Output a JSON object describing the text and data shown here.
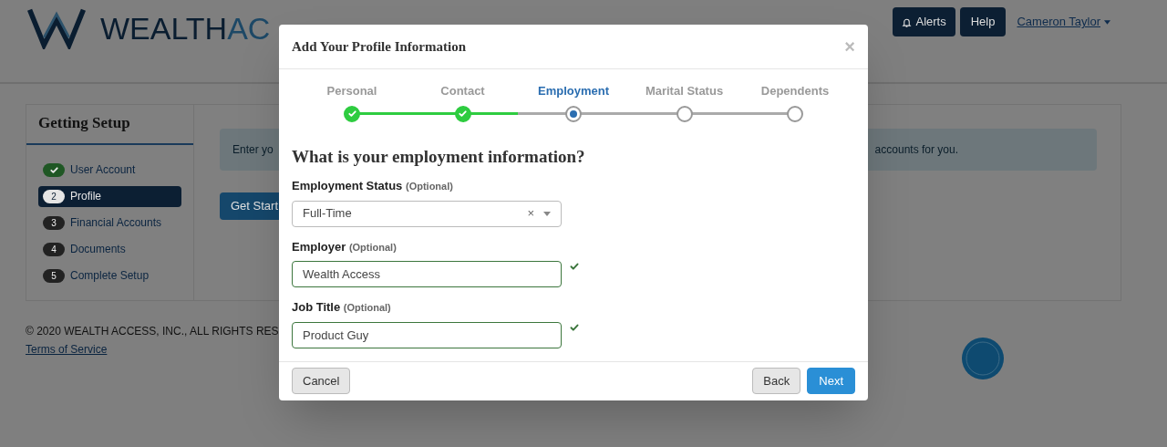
{
  "header": {
    "logo": {
      "dark": "WEALTH",
      "light": "AC"
    },
    "alerts_button": "Alerts",
    "help_button": "Help",
    "user_menu": "Cameron Taylor"
  },
  "sidebar": {
    "title": "Getting Setup",
    "items": [
      {
        "label": "User Account",
        "done": true,
        "selected": false
      },
      {
        "badge": "2",
        "label": "Profile",
        "done": false,
        "selected": true
      },
      {
        "badge": "3",
        "label": "Financial Accounts",
        "done": false,
        "selected": false
      },
      {
        "badge": "4",
        "label": "Documents",
        "done": false,
        "selected": false
      },
      {
        "badge": "5",
        "label": "Complete Setup",
        "done": false,
        "selected": false
      }
    ]
  },
  "main": {
    "notice_start": "Enter yo",
    "notice_end": "accounts for you.",
    "start_button": "Get Start"
  },
  "footer": {
    "copyright": "© 2020 WEALTH ACCESS, INC., ALL RIGHTS RES",
    "terms_link": "Terms of Service"
  },
  "modal": {
    "title": "Add Your Profile Information",
    "close": "×",
    "steps": [
      {
        "label": "Personal",
        "done": true,
        "selected": false
      },
      {
        "label": "Contact",
        "done": true,
        "selected": false
      },
      {
        "label": "Employment",
        "done": false,
        "selected": true
      },
      {
        "label": "Marital Status",
        "done": false,
        "selected": false
      },
      {
        "label": "Dependents",
        "done": false,
        "selected": false
      }
    ],
    "question": "What is your employment information?",
    "fields": [
      {
        "kind": "select",
        "label": "Employment Status",
        "hint": "(Optional)",
        "value": "Full-Time",
        "clear": "×",
        "valid": false
      },
      {
        "kind": "text",
        "label": "Employer",
        "hint": "(Optional)",
        "value": "Wealth Access",
        "valid": true
      },
      {
        "kind": "text",
        "label": "Job Title",
        "hint": "(Optional)",
        "value": "Product Guy",
        "valid": true
      }
    ],
    "cancel_button": "Cancel",
    "back_button": "Back",
    "next_button": "Next"
  }
}
